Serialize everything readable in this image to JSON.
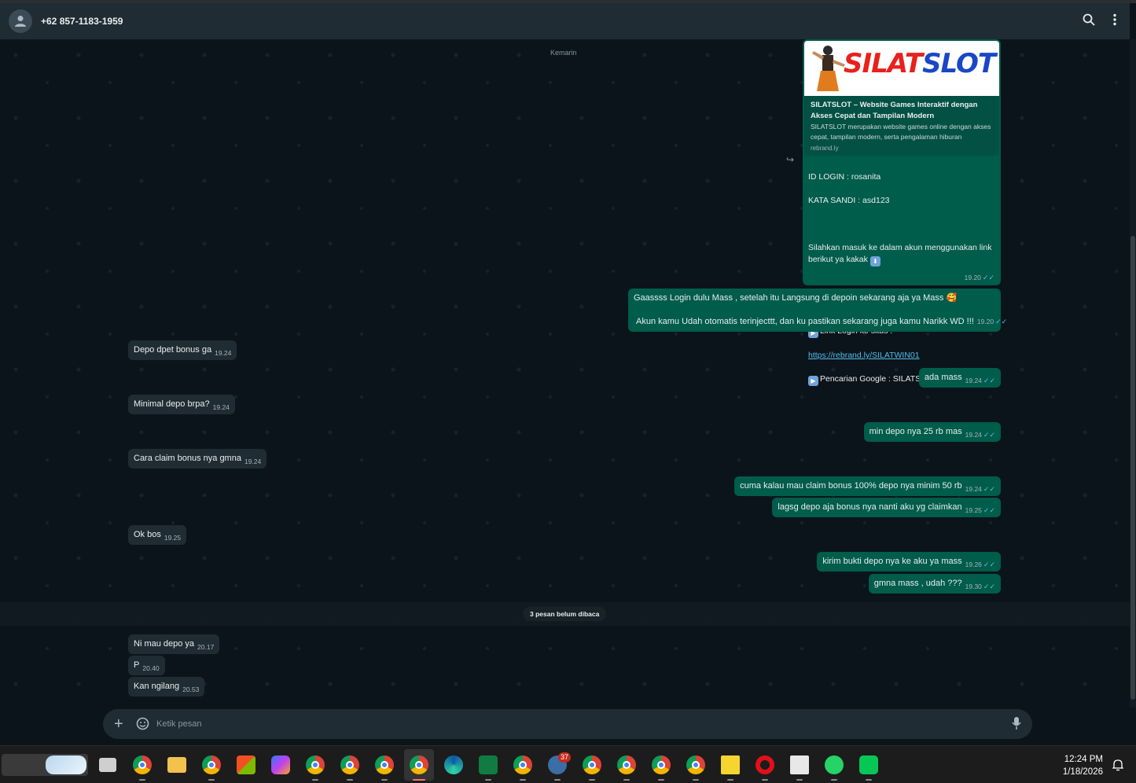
{
  "header": {
    "contact": "+62 857-1183-1959"
  },
  "chat": {
    "date_label": "Kemarin",
    "link_preview": {
      "banner_text_red": "SILAT",
      "banner_text_blue": "SLOT",
      "title": "SILATSLOT – Website Games Interaktif dengan Akses Cepat dan Tampilan Modern",
      "description": "SILATSLOT merupakan website games online dengan akses cepat, tampilan modern, serta pengalaman hiburan",
      "domain": "rebrand.ly"
    },
    "big_message": {
      "line1": "ID LOGIN : rosanita",
      "line2": "KATA SANDI : asd123",
      "line3": "Silahkan masuk ke dalam akun menggunakan link berikut ya kakak",
      "separator": "=====================================",
      "line4": "Link Login ke situs  :",
      "link": "https://rebrand.ly/SILATWIN01",
      "line5": "Pencarian Google : SILATSLOT",
      "time": "19.20"
    },
    "msg_gaass": {
      "line1": "Gaassss Login dulu Mass  , setelah itu Langsung di depoin sekarang aja ya Mass 🥰",
      "line2": "Akun kamu Udah otomatis terinjecttt, dan ku pastikan sekarang juga kamu Narikk WD !!!",
      "time": "19.20"
    },
    "messages": [
      {
        "text": "Depo dpet bonus ga",
        "time": "19.24"
      },
      {
        "text": "ada mass",
        "time": "19.24"
      },
      {
        "text": "Minimal depo brpa?",
        "time": "19.24"
      },
      {
        "text": "min depo nya 25 rb mas",
        "time": "19.24"
      },
      {
        "text": "Cara claim bonus nya gmna",
        "time": "19.24"
      },
      {
        "text": "cuma kalau mau claim bonus 100% depo nya minim 50 rb",
        "time": "19.24"
      },
      {
        "text": "lagsg depo aja bonus nya nanti aku yg claimkan",
        "time": "19.25"
      },
      {
        "text": "Ok bos",
        "time": "19.25"
      },
      {
        "text": "kirim bukti depo nya ke aku ya mass",
        "time": "19.26"
      },
      {
        "text": "gmna mass , udah ???",
        "time": "19.30"
      },
      {
        "text": "Ni mau depo ya",
        "time": "20.17"
      },
      {
        "text": "P",
        "time": "20.40"
      },
      {
        "text": "Kan ngilang",
        "time": "20.53"
      }
    ],
    "unread_label": "3 pesan belum dibaca"
  },
  "composer": {
    "placeholder": "Ketik pesan"
  },
  "taskbar": {
    "badge_count": "37",
    "time": "12:24 PM",
    "date": "1/18/2026"
  },
  "colors": {
    "incoming_bubble": "#202c33",
    "outgoing_bubble": "#005c4b",
    "background": "#0b141a",
    "link": "#53bdeb"
  }
}
